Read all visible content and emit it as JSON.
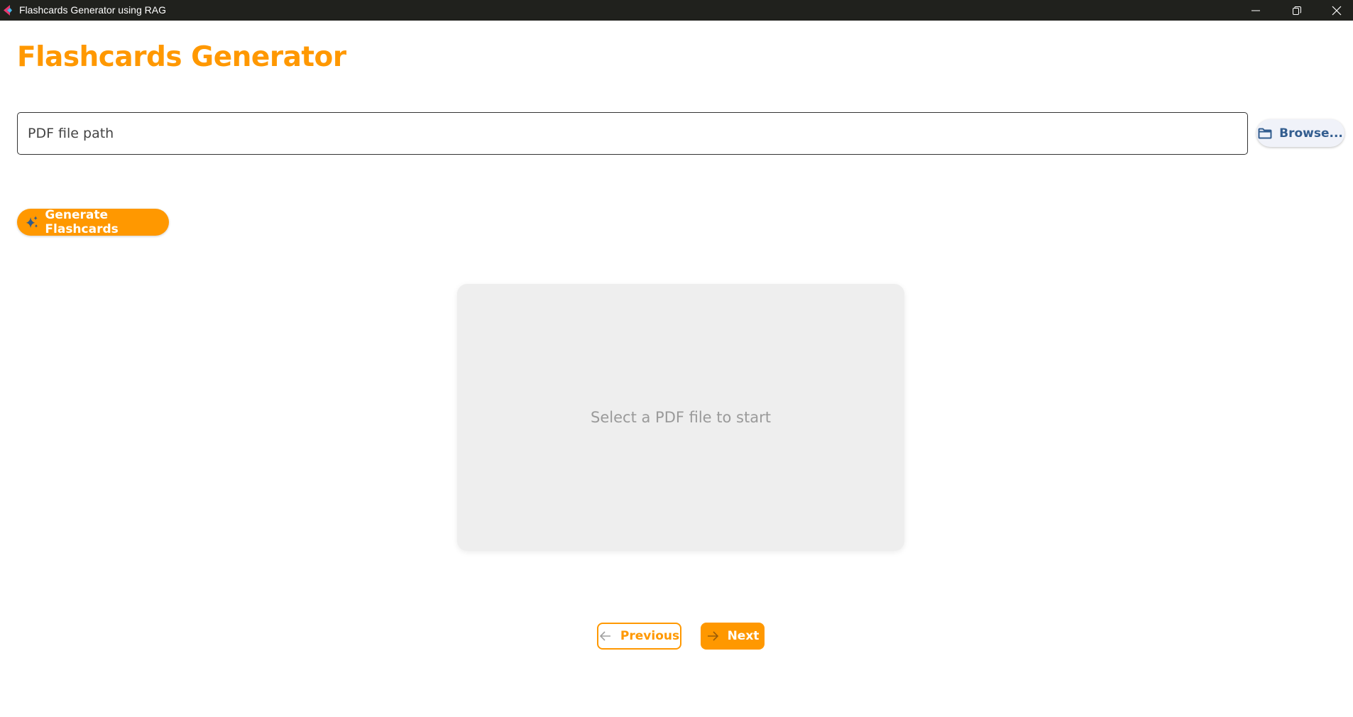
{
  "window": {
    "title": "Flashcards Generator using RAG"
  },
  "header": {
    "title": "Flashcards Generator"
  },
  "file_picker": {
    "placeholder": "PDF file path",
    "value": "",
    "browse_label": "Browse..."
  },
  "actions": {
    "generate_label": "Generate Flashcards"
  },
  "card": {
    "text": "Select a PDF file to start"
  },
  "navigation": {
    "previous_label": "Previous",
    "next_label": "Next"
  },
  "colors": {
    "accent": "#ff9800",
    "titlebar": "#20211d",
    "card_bg": "#eeeeee",
    "browse_text": "#335d8f"
  }
}
